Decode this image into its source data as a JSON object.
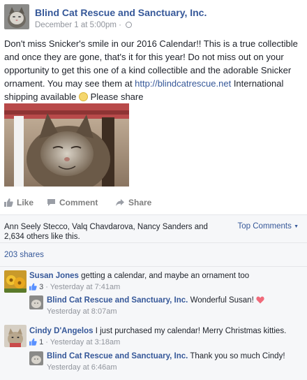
{
  "post": {
    "page_name": "Blind Cat Rescue and Sanctuary, Inc.",
    "timestamp": "December 1 at 5:00pm",
    "separator": " · ",
    "text_part1": "Don't miss Snicker's smile in our 2016 Calendar!! This is a true collectible and once they are gone, that's it for this year! Do not miss out on your opportunity to get this one of a kind collectible and the adorable Snicker ornament. You may see them at ",
    "link_text": "http://blindcatrescue.net",
    "text_part2": " International shipping available ",
    "text_part3": " Please share"
  },
  "actions": {
    "like": "Like",
    "comment": "Comment",
    "share": "Share"
  },
  "feedback": {
    "likes_summary": "Ann Seely Stecco, Valq Chavdarova, Nancy Sanders and 2,634 others like this.",
    "sort_label": "Top Comments",
    "shares": "203 shares"
  },
  "comments": [
    {
      "author": "Susan Jones",
      "text": " getting a calendar, and maybe an ornament too",
      "likes": "3",
      "time": " · Yesterday at 7:41am",
      "reply": {
        "author": "Blind Cat Rescue and Sanctuary, Inc.",
        "text": " Wonderful Susan! ",
        "time": "Yesterday at 8:07am"
      }
    },
    {
      "author": "Cindy D'Angelos",
      "text": " I just purchased my calendar! Merry Christmas kitties.",
      "likes": "1",
      "time": " · Yesterday at 3:18am",
      "reply": {
        "author": "Blind Cat Rescue and Sanctuary, Inc.",
        "text": " Thank you so much Cindy!",
        "time": "Yesterday at 6:46am"
      }
    }
  ],
  "colors": {
    "link": "#365899",
    "meta": "#90949c",
    "feedback_bg": "#f6f7f9"
  }
}
